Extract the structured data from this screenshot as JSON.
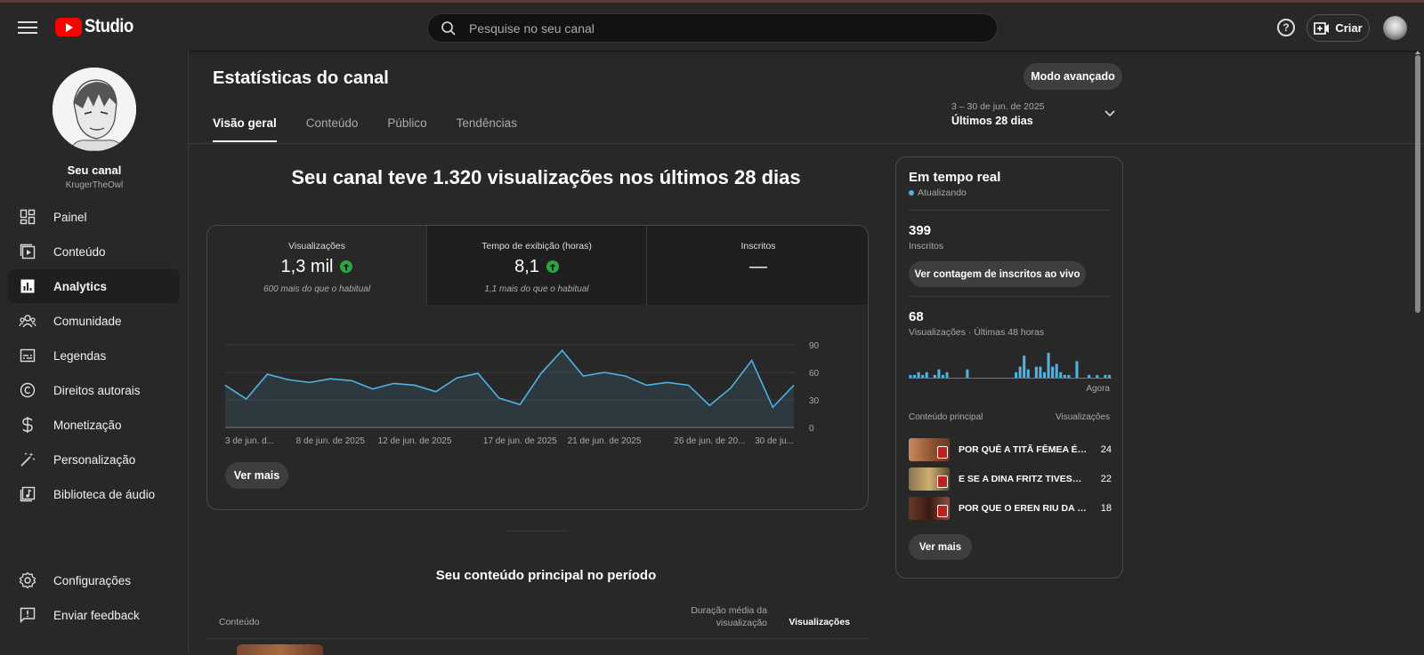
{
  "app": {
    "logo_text": "Studio"
  },
  "search": {
    "placeholder": "Pesquise no seu canal"
  },
  "header": {
    "create_label": "Criar",
    "help_label": "?"
  },
  "channel": {
    "name": "Seu canal",
    "handle": "KrugerTheOwl"
  },
  "sidebar": {
    "items": [
      {
        "label": "Painel",
        "icon": "dashboard-icon"
      },
      {
        "label": "Conteúdo",
        "icon": "content-icon"
      },
      {
        "label": "Analytics",
        "icon": "analytics-icon",
        "active": true
      },
      {
        "label": "Comunidade",
        "icon": "community-icon"
      },
      {
        "label": "Legendas",
        "icon": "subtitles-icon"
      },
      {
        "label": "Direitos autorais",
        "icon": "copyright-icon"
      },
      {
        "label": "Monetização",
        "icon": "monetization-icon"
      },
      {
        "label": "Personalização",
        "icon": "customization-icon"
      },
      {
        "label": "Biblioteca de áudio",
        "icon": "audio-library-icon"
      }
    ],
    "bottom": [
      {
        "label": "Configurações",
        "icon": "settings-icon"
      },
      {
        "label": "Enviar feedback",
        "icon": "feedback-icon"
      }
    ]
  },
  "page": {
    "title": "Estatísticas do canal",
    "advanced_button": "Modo avançado",
    "tabs": [
      {
        "label": "Visão geral",
        "active": true
      },
      {
        "label": "Conteúdo"
      },
      {
        "label": "Público"
      },
      {
        "label": "Tendências"
      }
    ],
    "date_range": {
      "sub": "3 – 30 de jun. de 2025",
      "main": "Últimos 28 dias"
    }
  },
  "overview": {
    "headline": "Seu canal teve 1.320 visualizações nos últimos 28 dias",
    "metrics": [
      {
        "title": "Visualizações",
        "value": "1,3 mil",
        "trend": "up",
        "compare": "600 mais do que o habitual"
      },
      {
        "title": "Tempo de exibição (horas)",
        "value": "8,1",
        "trend": "up",
        "compare": "1,1 mais do que o habitual"
      },
      {
        "title": "Inscritos",
        "value": "—",
        "trend": "none",
        "compare": ""
      }
    ],
    "see_more": "Ver mais"
  },
  "chart_data": {
    "type": "area",
    "x": [
      "3 de jun.",
      "4 de jun.",
      "5 de jun.",
      "6 de jun.",
      "7 de jun.",
      "8 de jun. de 2025",
      "9 de jun.",
      "10 de jun.",
      "11 de jun.",
      "12 de jun. de 2025",
      "13 de jun.",
      "14 de jun.",
      "15 de jun.",
      "16 de jun.",
      "17 de jun. de 2025",
      "18 de jun.",
      "19 de jun.",
      "20 de jun.",
      "21 de jun. de 2025",
      "22 de jun.",
      "23 de jun.",
      "24 de jun.",
      "25 de jun.",
      "26 de jun. de 2025",
      "27 de jun.",
      "28 de jun.",
      "29 de jun.",
      "30 de jun."
    ],
    "tick_labels": [
      "3 de jun. d...",
      "8 de jun. de 2025",
      "12 de jun. de 2025",
      "17 de jun. de 2025",
      "21 de jun. de 2025",
      "26 de jun. de 20...",
      "30 de ju..."
    ],
    "tick_index": [
      0,
      5,
      9,
      14,
      18,
      23,
      27
    ],
    "series": [
      {
        "values": [
          46,
          31,
          58,
          52,
          49,
          53,
          51,
          42,
          48,
          46,
          39,
          54,
          59,
          32,
          25,
          59,
          84,
          56,
          60,
          56,
          46,
          49,
          46,
          24,
          43,
          73,
          22,
          46
        ]
      }
    ],
    "ylim": [
      0,
      90
    ],
    "yticks": [
      0,
      30,
      60,
      90
    ],
    "grid": true,
    "color": "#4fb3e3"
  },
  "top_content": {
    "title": "Seu conteúdo principal no período",
    "col_content": "Conteúdo",
    "col_duration": "Duração média da visualização",
    "col_views": "Visualizações"
  },
  "realtime": {
    "title": "Em tempo real",
    "status": "Atualizando",
    "subscribers_value": "399",
    "subscribers_label": "Inscritos",
    "live_count_button": "Ver contagem de inscritos ao vivo",
    "views_value": "68",
    "views_label": "Visualizações · Últimas 48 horas",
    "now_label": "Agora",
    "bars": [
      1,
      1,
      2,
      1,
      2,
      0,
      1,
      3,
      1,
      2,
      0,
      0,
      0,
      0,
      3,
      0,
      0,
      0,
      0,
      0,
      0,
      0,
      0,
      0,
      0,
      0,
      2,
      4,
      8,
      3,
      0,
      4,
      4,
      2,
      9,
      4,
      5,
      2,
      1,
      1,
      0,
      6,
      0,
      0,
      1,
      0,
      1,
      0,
      1,
      1
    ],
    "col_content": "Conteúdo principal",
    "col_views": "Visualizações",
    "top": [
      {
        "title": "POR QUÊ A TITÃ FÊMEA É TÃO FORTE?",
        "views": "24"
      },
      {
        "title": "E SE A DINA FRITZ TIVESSE COMIDO O EREN?",
        "views": "22"
      },
      {
        "title": "POR QUE O EREN RIU DA MORTE DA MÃE?",
        "views": "18"
      }
    ],
    "see_more": "Ver mais"
  }
}
